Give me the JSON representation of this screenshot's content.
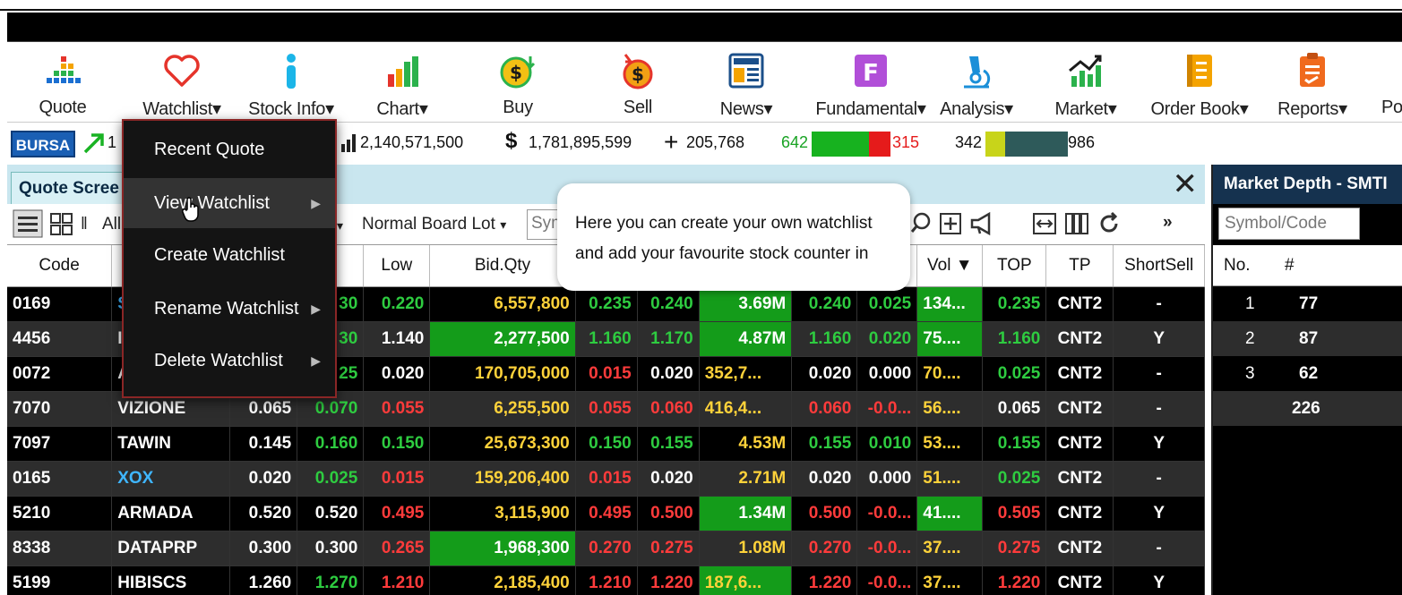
{
  "toolbar": {
    "items": [
      {
        "label": "Quote",
        "icon": "quote-bars-icon"
      },
      {
        "label": "Watchlist",
        "icon": "heart-icon",
        "dropdown": true
      },
      {
        "label": "Stock Info",
        "icon": "info-icon",
        "dropdown": true
      },
      {
        "label": "Chart",
        "icon": "bar-chart-icon",
        "dropdown": true
      },
      {
        "label": "Buy",
        "icon": "buy-coin-icon"
      },
      {
        "label": "Sell",
        "icon": "sell-coin-icon"
      },
      {
        "label": "News",
        "icon": "newspaper-icon",
        "dropdown": true
      },
      {
        "label": "Fundamental",
        "icon": "fundamental-f-icon",
        "dropdown": true
      },
      {
        "label": "Analysis",
        "icon": "microscope-icon",
        "dropdown": true
      },
      {
        "label": "Market",
        "icon": "market-trend-icon",
        "dropdown": true
      },
      {
        "label": "Order Book",
        "icon": "order-book-icon",
        "dropdown": true
      },
      {
        "label": "Reports",
        "icon": "reports-icon",
        "dropdown": true
      },
      {
        "label": "Po",
        "icon": ""
      }
    ],
    "caret": "▾"
  },
  "summary": {
    "exchange": "BURSA",
    "index_partial": "1",
    "volume": "2,140,571,500",
    "value": "1,781,895,599",
    "trades": "205,768",
    "up_count": "642",
    "down_count": "315",
    "unchanged_count": "342",
    "untraded_count": "986",
    "colors": {
      "up": "#17b21f",
      "down": "#e51b1b",
      "unch": "#c8d41a",
      "untraded": "#2e5a5a"
    }
  },
  "panel": {
    "tab_title": "Quote Scree",
    "close": "✕",
    "filter_all": "All",
    "board_lot": "Normal Board Lot",
    "symbol_placeholder": "Sym",
    "more": "»"
  },
  "table": {
    "headers": [
      "Code",
      "",
      "",
      "n",
      "Low",
      "Bid.Qty",
      "",
      "",
      "",
      "",
      "",
      "Vol ▼",
      "TOP",
      "TP",
      "ShortSell"
    ],
    "rows": [
      {
        "code": "0169",
        "name": "S",
        "c2": "",
        "c3": "30",
        "low": "0.220",
        "bidqty": "6,557,800",
        "bid": "0.235",
        "ask": "0.240",
        "askqty": "3.69M",
        "last": "0.240",
        "chg": "0.025",
        "vol": "134...",
        "top": "0.235",
        "tp": "CNT2",
        "ss": "-"
      },
      {
        "code": "4456",
        "name": "I",
        "c2": "",
        "c3": "30",
        "low": "1.140",
        "bidqty": "2,277,500",
        "bid": "1.160",
        "ask": "1.170",
        "askqty": "4.87M",
        "last": "1.160",
        "chg": "0.020",
        "vol": "75....",
        "top": "1.160",
        "tp": "CNT2",
        "ss": "Y"
      },
      {
        "code": "0072",
        "name": "A",
        "c2": "",
        "c3": "25",
        "low": "0.020",
        "bidqty": "170,705,000",
        "bid": "0.015",
        "ask": "0.020",
        "askqty": "352,7...",
        "last": "0.020",
        "chg": "0.000",
        "vol": "70....",
        "top": "0.025",
        "tp": "CNT2",
        "ss": "-"
      },
      {
        "code": "7070",
        "name": "VIZIONE",
        "c2": "0.065",
        "c3": "0.070",
        "low": "0.055",
        "bidqty": "6,255,500",
        "bid": "0.055",
        "ask": "0.060",
        "askqty": "416,4...",
        "last": "0.060",
        "chg": "-0.0...",
        "vol": "56....",
        "top": "0.065",
        "tp": "CNT2",
        "ss": "-"
      },
      {
        "code": "7097",
        "name": "TAWIN",
        "c2": "0.145",
        "c3": "0.160",
        "low": "0.150",
        "bidqty": "25,673,300",
        "bid": "0.150",
        "ask": "0.155",
        "askqty": "4.53M",
        "last": "0.155",
        "chg": "0.010",
        "vol": "53....",
        "top": "0.155",
        "tp": "CNT2",
        "ss": "Y"
      },
      {
        "code": "0165",
        "name": "XOX",
        "c2": "0.020",
        "c3": "0.025",
        "low": "0.015",
        "bidqty": "159,206,400",
        "bid": "0.015",
        "ask": "0.020",
        "askqty": "2.71M",
        "last": "0.020",
        "chg": "0.000",
        "vol": "51....",
        "top": "0.025",
        "tp": "CNT2",
        "ss": "-"
      },
      {
        "code": "5210",
        "name": "ARMADA",
        "c2": "0.520",
        "c3": "0.520",
        "low": "0.495",
        "bidqty": "3,115,900",
        "bid": "0.495",
        "ask": "0.500",
        "askqty": "1.34M",
        "last": "0.500",
        "chg": "-0.0...",
        "vol": "41....",
        "top": "0.505",
        "tp": "CNT2",
        "ss": "Y"
      },
      {
        "code": "8338",
        "name": "DATAPRP",
        "c2": "0.300",
        "c3": "0.300",
        "low": "0.265",
        "bidqty": "1,968,300",
        "bid": "0.270",
        "ask": "0.275",
        "askqty": "1.08M",
        "last": "0.270",
        "chg": "-0.0...",
        "vol": "37....",
        "top": "0.275",
        "tp": "CNT2",
        "ss": "-"
      },
      {
        "code": "5199",
        "name": "HIBISCS",
        "c2": "1.260",
        "c3": "1.270",
        "low": "1.210",
        "bidqty": "2,185,400",
        "bid": "1.210",
        "ask": "1.220",
        "askqty": "187,6...",
        "last": "1.220",
        "chg": "-0.0...",
        "vol": "37....",
        "top": "1.220",
        "tp": "CNT2",
        "ss": "Y"
      }
    ]
  },
  "depth": {
    "title": "Market Depth - SMTI",
    "search_placeholder": "Symbol/Code",
    "headers": [
      "No.",
      "#"
    ],
    "rows": [
      {
        "no": "1",
        "count": "77"
      },
      {
        "no": "2",
        "count": "87"
      },
      {
        "no": "3",
        "count": "62"
      },
      {
        "no": "",
        "count": "226"
      }
    ]
  },
  "watchlist_menu": {
    "items": [
      {
        "label": "Recent Quote",
        "submenu": false
      },
      {
        "label": "View Watchlist",
        "submenu": true
      },
      {
        "label": "Create Watchlist",
        "submenu": false
      },
      {
        "label": "Rename Watchlist",
        "submenu": true
      },
      {
        "label": "Delete Watchlist",
        "submenu": true
      }
    ],
    "arrow": "▶"
  },
  "tooltip": {
    "line1": "Here you can create your own watchlist",
    "line2": "and add your favourite stock counter in"
  }
}
